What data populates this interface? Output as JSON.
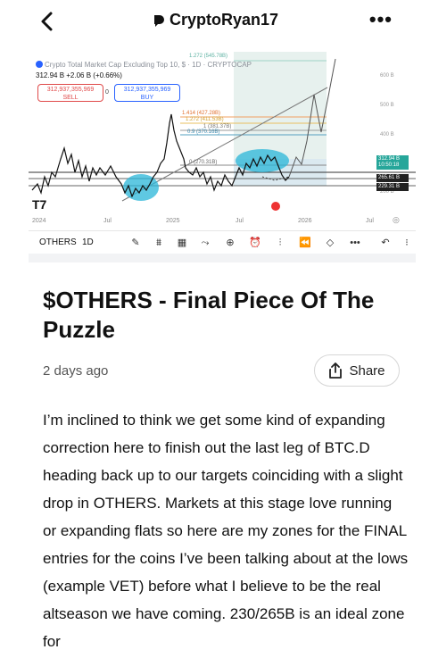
{
  "header": {
    "title": "CryptoRyan17"
  },
  "chart": {
    "legend_line": "Crypto Total Market Cap Excluding Top 10, $ · 1D · CRYPTOCAP",
    "price_line": "312.94 B  +2.06 B (+0.66%)",
    "sell_price": "312,937,355,969",
    "sell_label": "SELL",
    "spread": "0",
    "buy_price": "312,937,355,969",
    "buy_label": "BUY",
    "fib_labels": [
      "1.414 (427.28B)",
      "1.272 (411.53B)",
      "1 (381.37B)",
      "0.9 (370.16B)",
      "0 (270.31B)",
      "1.272 (545.78B)"
    ],
    "x_labels": [
      "2024",
      "Jul",
      "2025",
      "Jul",
      "2026",
      "Jul"
    ],
    "y_labels": [
      "600 B",
      "500 B",
      "400 B",
      "200 B"
    ],
    "price_tags": [
      {
        "text": "312.94 B\n10:50:18",
        "color": "#26a69a"
      },
      {
        "text": "265.61 B",
        "color": "#222222"
      },
      {
        "text": "229.31 B",
        "color": "#222222"
      }
    ],
    "toolbar": {
      "symbol": "OTHERS",
      "interval": "1D"
    }
  },
  "article": {
    "title": "$OTHERS - Final Piece Of The Puzzle",
    "time": "2 days ago",
    "share_label": "Share",
    "body": "I’m inclined to think we get some kind of expanding correction here to finish out the last leg of BTC.D heading back up to our targets coinciding with a slight drop in OTHERS. Markets at this stage love running or expanding flats so here are my zones for the FINAL entries for the coins I’ve been talking about at the lows (example VET) before what I believe to be the real altseason we have coming. 230/265B is an ideal zone for"
  },
  "colors": {
    "accent_blue": "#2962ff",
    "sell_red": "#e04a4a",
    "teal": "#26a69a",
    "highlight": "#29b6d8"
  }
}
